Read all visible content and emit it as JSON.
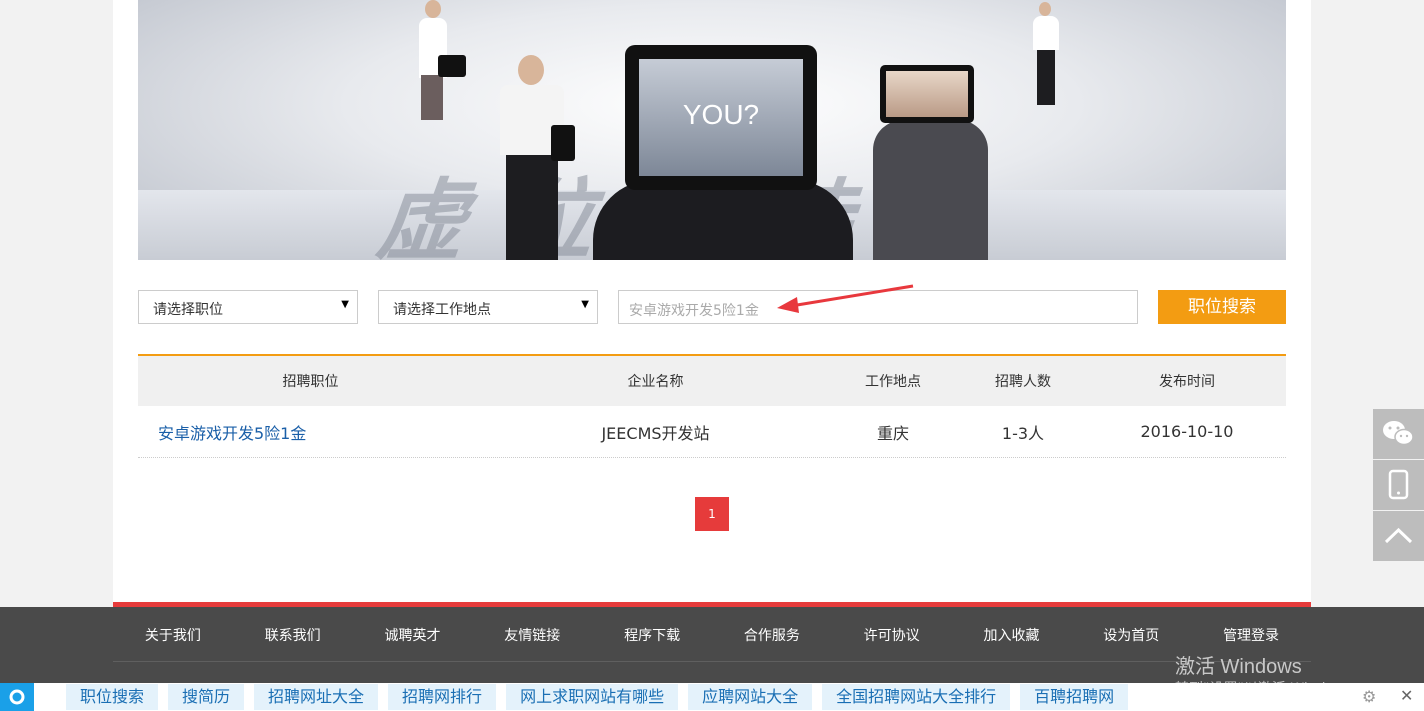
{
  "banner": {
    "big_text": "虚位以待",
    "tablet_text": "YOU?"
  },
  "search": {
    "position_select": "请选择职位",
    "location_select": "请选择工作地点",
    "keyword_placeholder": "安卓游戏开发5险1金",
    "button_label": "职位搜索"
  },
  "table": {
    "headers": [
      "招聘职位",
      "企业名称",
      "工作地点",
      "招聘人数",
      "发布时间"
    ],
    "rows": [
      {
        "position": "安卓游戏开发5险1金",
        "company": "JEECMS开发站",
        "location": "重庆",
        "count": "1-3人",
        "date": "2016-10-10"
      }
    ]
  },
  "pagination": {
    "current": "1"
  },
  "footer": {
    "links": [
      "关于我们",
      "联系我们",
      "诚聘英才",
      "友情链接",
      "程序下载",
      "合作服务",
      "许可协议",
      "加入收藏",
      "设为首页",
      "管理登录"
    ]
  },
  "watermark": {
    "line1": "激活 Windows",
    "line2": "转到\"设置\"以激活 Windows。"
  },
  "taskbar": {
    "items": [
      "职位搜索",
      "搜简历",
      "招聘网址大全",
      "招聘网排行",
      "网上求职网站有哪些",
      "应聘网站大全",
      "全国招聘网站大全排行",
      "百聘招聘网"
    ]
  },
  "colors": {
    "accent": "#f39c12",
    "red": "#e63b3b",
    "link": "#1a5fa8",
    "footer": "#4a4a4a"
  },
  "side_tools": [
    "wechat-icon",
    "mobile-icon",
    "back-to-top-icon"
  ]
}
